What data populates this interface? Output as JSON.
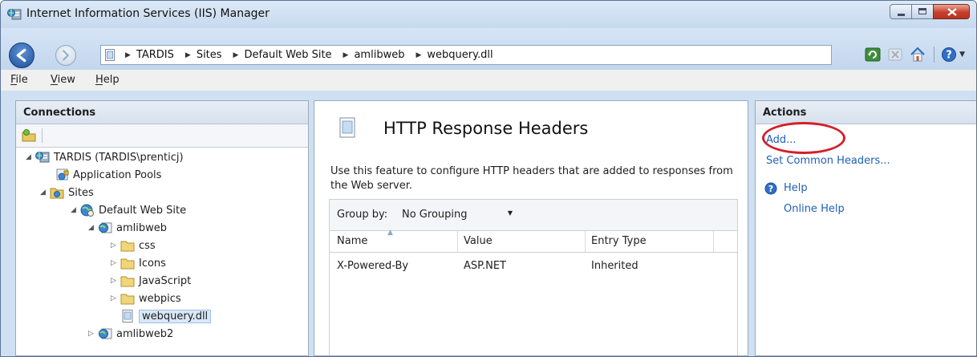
{
  "window": {
    "title": "Internet Information Services (IIS) Manager"
  },
  "address": {
    "crumbs": [
      "TARDIS",
      "Sites",
      "Default Web Site",
      "amlibweb",
      "webquery.dll"
    ]
  },
  "menu": [
    "File",
    "View",
    "Help"
  ],
  "connections": {
    "header": "Connections",
    "tree": [
      "TARDIS (TARDIS\\prenticj)",
      "Application Pools",
      "Sites",
      "Default Web Site",
      "amlibweb",
      "css",
      "Icons",
      "JavaScript",
      "webpics",
      "webquery.dll",
      "amlibweb2"
    ]
  },
  "feature": {
    "title": "HTTP Response Headers",
    "description": "Use this feature to configure HTTP headers that are added to responses from the Web server.",
    "group_by_label": "Group by:",
    "group_by_value": "No Grouping",
    "columns": [
      "Name",
      "Value",
      "Entry Type"
    ],
    "rows": [
      {
        "name": "X-Powered-By",
        "value": "ASP.NET",
        "entry_type": "Inherited"
      }
    ]
  },
  "actions": {
    "header": "Actions",
    "add": "Add...",
    "set_common": "Set Common Headers...",
    "help": "Help",
    "online_help": "Online Help"
  },
  "colors": {
    "link": "#1f5fb8",
    "highlight_ring": "#d41f2a",
    "close_button": "#c7402b"
  },
  "icons": [
    "iis-app-icon",
    "back-arrow-icon",
    "forward-arrow-icon",
    "page-icon",
    "refresh-icon",
    "stop-icon",
    "home-icon",
    "help-icon",
    "folder-icon",
    "globe-icon",
    "server-icon",
    "app-pool-icon",
    "sites-folder-icon"
  ]
}
